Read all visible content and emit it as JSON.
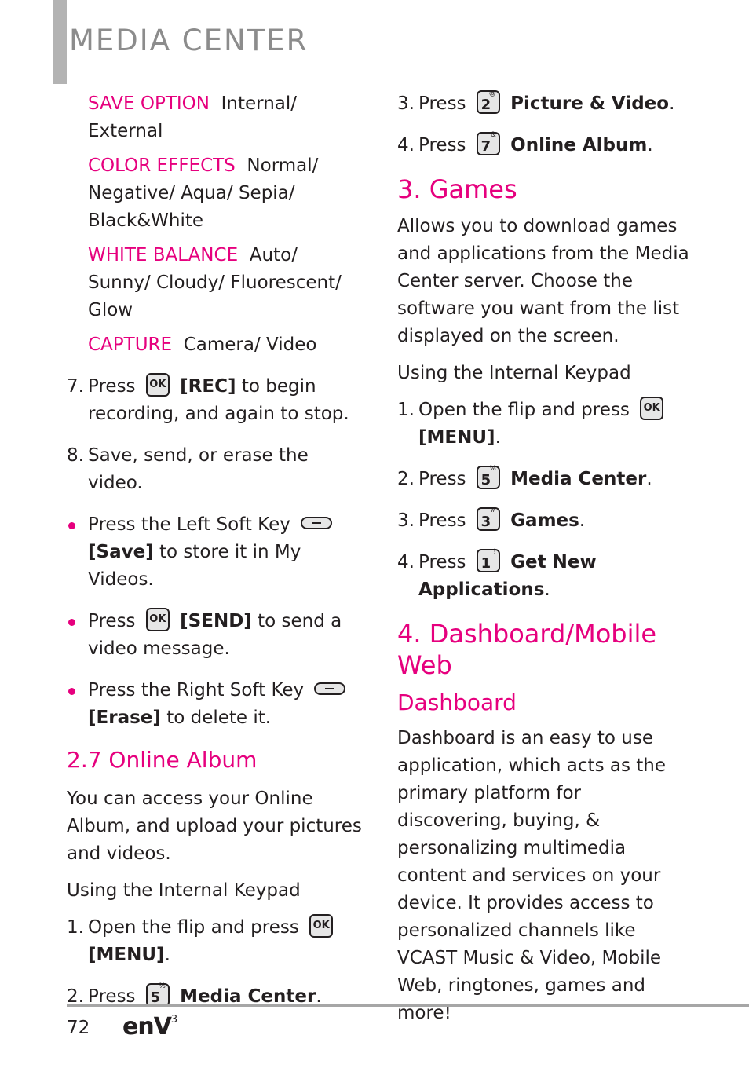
{
  "header": {
    "title": "MEDIA CENTER"
  },
  "left": {
    "options": [
      {
        "label": "SAVE OPTION",
        "value": "Internal/ External"
      },
      {
        "label": "COLOR EFFECTS",
        "value": "Normal/ Negative/ Aqua/ Sepia/ Black&White"
      },
      {
        "label": "WHITE BALANCE",
        "value": "Auto/ Sunny/ Cloudy/ Fluorescent/ Glow"
      },
      {
        "label": "CAPTURE",
        "value": "Camera/ Video"
      }
    ],
    "step7": {
      "num": "7.",
      "pre": "Press",
      "key": "OK",
      "action": "[REC]",
      "post": "to begin recording, and again to stop."
    },
    "step8": {
      "num": "8.",
      "text": "Save, send, or erase the video."
    },
    "bullets": [
      {
        "pre": "Press the Left Soft Key",
        "action": "[Save]",
        "post": "to store it in My Videos."
      },
      {
        "pre": "Press",
        "key": "OK",
        "action": "[SEND]",
        "post": "to send a video message."
      },
      {
        "pre": "Press the Right Soft Key",
        "action": "[Erase]",
        "post": "to delete it."
      }
    ],
    "online_album": {
      "heading": "2.7 Online Album",
      "para": "You can access your Online Album, and upload your pictures and videos.",
      "keypad_label": "Using the Internal Keypad",
      "steps": [
        {
          "num": "1.",
          "pre": "Open the flip and press",
          "key": "OK",
          "action": "[MENU]",
          "post": "."
        },
        {
          "num": "2.",
          "pre": "Press",
          "key": "5",
          "key_sup": "%",
          "action": "Media Center",
          "post": "."
        }
      ]
    }
  },
  "right": {
    "album_steps": [
      {
        "num": "3.",
        "pre": "Press",
        "key": "2",
        "key_sup": "@",
        "action": "Picture & Video",
        "post": "."
      },
      {
        "num": "4.",
        "pre": "Press",
        "key": "7",
        "key_sup": "&",
        "action": "Online Album",
        "post": "."
      }
    ],
    "games": {
      "heading": "3. Games",
      "para": "Allows you to download games and applications  from the Media Center server. Choose the software you want from the list displayed on the screen.",
      "keypad_label": "Using the Internal Keypad",
      "steps": [
        {
          "num": "1.",
          "pre": "Open the flip and press",
          "key": "OK",
          "action": "[MENU]",
          "post": "."
        },
        {
          "num": "2.",
          "pre": "Press",
          "key": "5",
          "key_sup": "%",
          "action": "Media Center",
          "post": "."
        },
        {
          "num": "3.",
          "pre": "Press",
          "key": "3",
          "key_sup": "#",
          "action": "Games",
          "post": "."
        },
        {
          "num": "4.",
          "pre": "Press",
          "key": "1",
          "key_sup": "!",
          "action": "Get New Applications",
          "post": "."
        }
      ]
    },
    "dashboard": {
      "heading": "4. Dashboard/Mobile Web",
      "subheading": "Dashboard",
      "para": "Dashboard is an easy to use application, which acts as the primary platform for discovering, buying, & personalizing multimedia content and services on your device. It provides access to personalized channels like VCAST Music & Video, Mobile Web, ringtones, games and more!"
    }
  },
  "footer": {
    "page_number": "72",
    "brand": "enV",
    "brand_sup": "3"
  },
  "colors": {
    "accent": "#e6007e",
    "header_gray": "#8c8c8c",
    "bar_gray": "#b3b3b3",
    "text": "#231f20"
  }
}
